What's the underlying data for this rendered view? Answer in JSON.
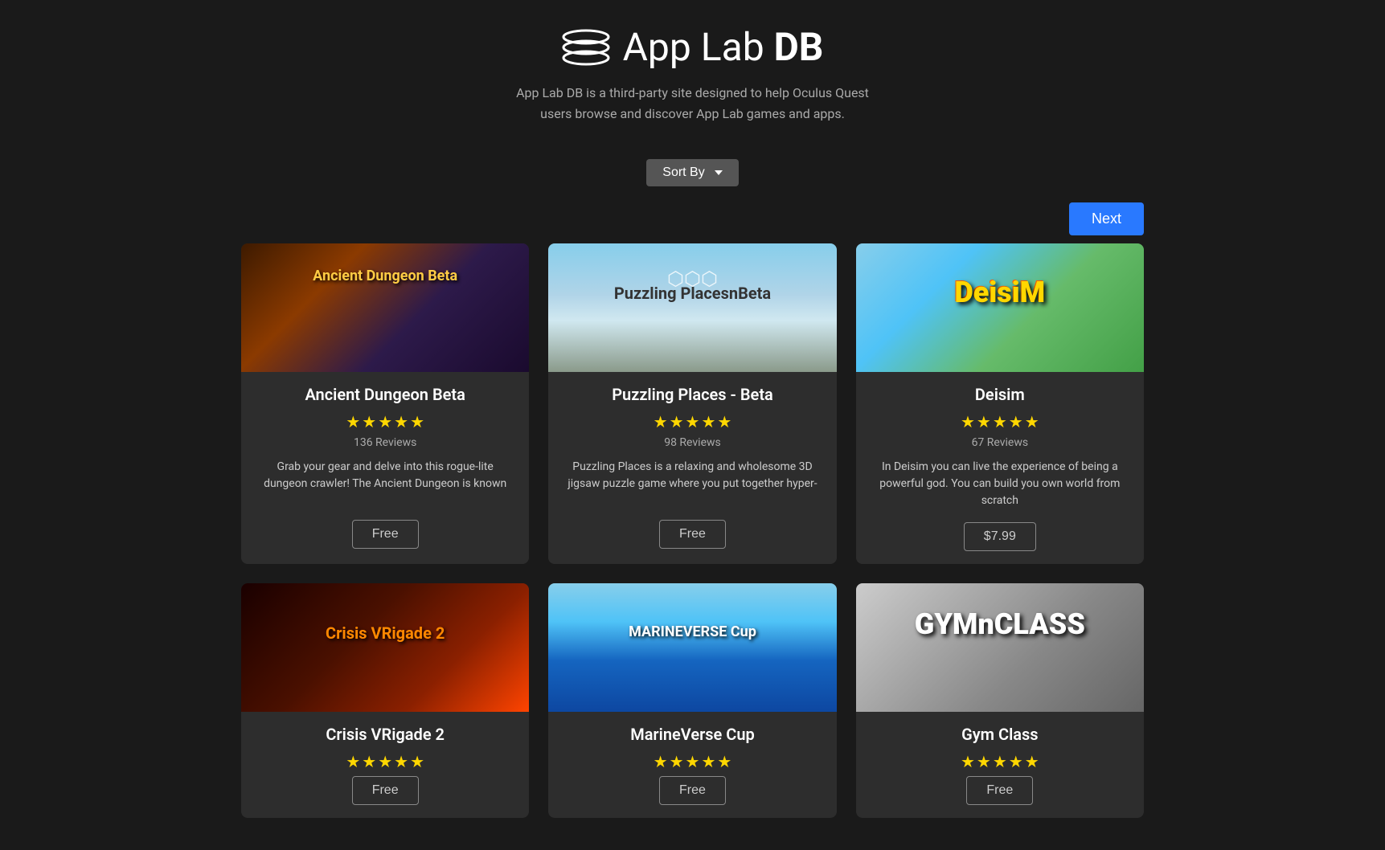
{
  "header": {
    "logo_text_light": "App Lab ",
    "logo_text_bold": "DB",
    "subtitle_line1": "App Lab DB is a third-party site designed to help Oculus Quest",
    "subtitle_line2": "users browse and discover App Lab games and apps."
  },
  "sort": {
    "label": "Sort By"
  },
  "pagination": {
    "next_label": "Next"
  },
  "cards": [
    {
      "id": "ancient-dungeon-beta",
      "title": "Ancient Dungeon Beta",
      "stars": 5,
      "reviews": "136 Reviews",
      "description": "Grab your gear and delve into this rogue-lite dungeon crawler! The Ancient Dungeon is known",
      "price": "Free",
      "image_class": "img-ancient"
    },
    {
      "id": "puzzling-places-beta",
      "title": "Puzzling Places - Beta",
      "stars": 5,
      "reviews": "98 Reviews",
      "description": "Puzzling Places is a relaxing and wholesome 3D jigsaw puzzle game where you put together hyper-",
      "price": "Free",
      "image_class": "img-puzzling"
    },
    {
      "id": "deisim",
      "title": "Deisim",
      "stars": 5,
      "reviews": "67 Reviews",
      "description": "In Deisim you can live the experience of being a powerful god. You can build you own world from scratch",
      "price": "$7.99",
      "image_class": "img-deisim"
    },
    {
      "id": "crisis-vrigade-2",
      "title": "Crisis VRigade 2",
      "stars": 5,
      "reviews": "",
      "description": "",
      "price": "Free",
      "image_class": "img-crisis"
    },
    {
      "id": "marineverse-cup",
      "title": "MarineVerse Cup",
      "stars": 5,
      "reviews": "",
      "description": "",
      "price": "Free",
      "image_class": "img-marine"
    },
    {
      "id": "gym-class",
      "title": "Gym Class",
      "stars": 5,
      "reviews": "",
      "description": "",
      "price": "Free",
      "image_class": "img-gym"
    }
  ]
}
